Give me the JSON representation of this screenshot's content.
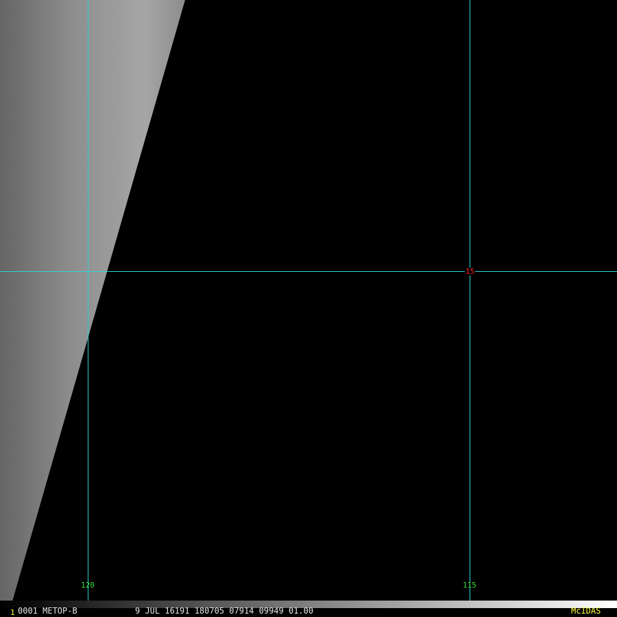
{
  "grid": {
    "longitude_labels": [
      "120",
      "115"
    ],
    "latitude_labels": [
      "15"
    ],
    "line_color": "#2fd3d3",
    "longitude_label_color": "#38e038",
    "latitude_label_color": "#ff2020"
  },
  "status_bar": {
    "frame_number": "1",
    "frame_info": "0001 METOP-B",
    "timestamp_info": "9 JUL 16191 180705 07914 09949 01.00",
    "software_tag": "McIDAS",
    "tag_color": "#ffff40"
  },
  "imagery": {
    "description_colors": {
      "cloud_light": "#c8c8c8",
      "cloud_dark": "#5a5a5a",
      "no_data": "#000000"
    }
  }
}
